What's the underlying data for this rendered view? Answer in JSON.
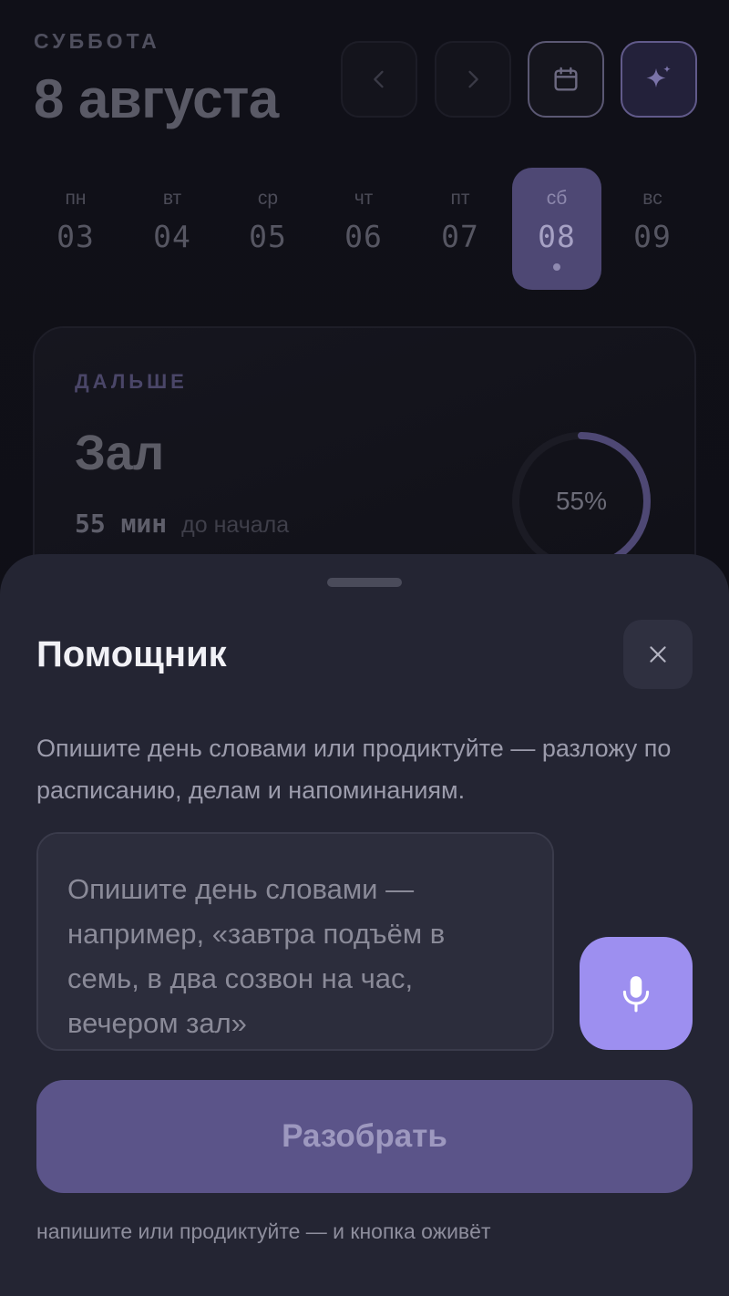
{
  "header": {
    "weekday": "СУББОТА",
    "date": "8 августа",
    "buttons": [
      {
        "icon": "chevron-left-icon"
      },
      {
        "icon": "chevron-right-icon"
      },
      {
        "icon": "calendar-icon"
      },
      {
        "icon": "sparkles-icon"
      }
    ]
  },
  "week": {
    "days": [
      {
        "name": "пн",
        "num": "03"
      },
      {
        "name": "вт",
        "num": "04"
      },
      {
        "name": "ср",
        "num": "05"
      },
      {
        "name": "чт",
        "num": "06"
      },
      {
        "name": "пт",
        "num": "07"
      },
      {
        "name": "сб",
        "num": "08",
        "active": true
      },
      {
        "name": "вс",
        "num": "09"
      }
    ]
  },
  "next": {
    "label": "ДАЛЬШЕ",
    "title": "Зал",
    "mins": "55 мин",
    "until": "до начала",
    "progress_text": "55%",
    "progress": 0.55
  },
  "assistant": {
    "title": "Помощник",
    "description": "Опишите день словами или продиктуйте — разложу по расписанию, делам и напоминаниям.",
    "input_placeholder": "Опишите день словами — например, «завтра подъём в семь, в два созвон на час, вечером зал»",
    "input_value": "",
    "parse_label": "Разобрать",
    "hint": "напишите или продиктуйте — и кнопка оживёт"
  },
  "colors": {
    "accent": "#9d8ff0",
    "accent_dim": "#5b5489",
    "sheet": "#242533",
    "background": "#0f0f16"
  }
}
